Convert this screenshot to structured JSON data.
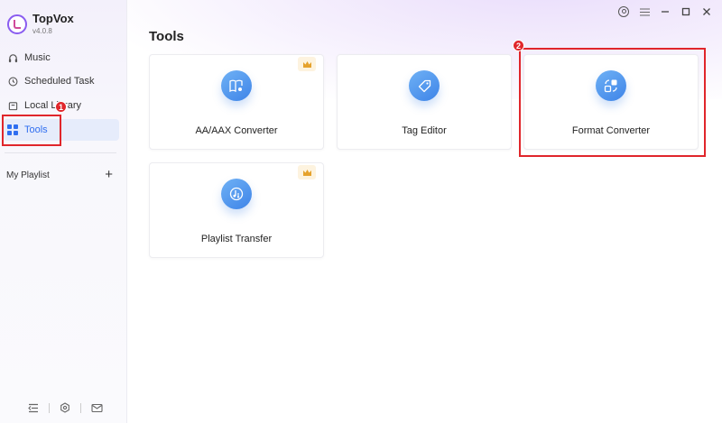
{
  "app": {
    "name": "TopVox",
    "version": "v4.0.8"
  },
  "sidebar": {
    "items": [
      {
        "label": "Music",
        "icon": "headphones-icon"
      },
      {
        "label": "Scheduled Task",
        "icon": "clock-icon"
      },
      {
        "label": "Local Library",
        "icon": "folder-icon"
      },
      {
        "label": "Tools",
        "icon": "grid-icon",
        "active": true
      }
    ],
    "playlist_label": "My Playlist",
    "add_symbol": "+"
  },
  "main": {
    "title": "Tools",
    "cards": [
      {
        "label": "AA/AAX Converter",
        "icon": "book-music-icon",
        "premium": true
      },
      {
        "label": "Tag Editor",
        "icon": "tag-icon",
        "premium": false
      },
      {
        "label": "Format Converter",
        "icon": "convert-icon",
        "premium": false
      },
      {
        "label": "Playlist Transfer",
        "icon": "music-transfer-icon",
        "premium": true
      }
    ]
  },
  "annotations": {
    "step1": "1",
    "step2": "2"
  },
  "colors": {
    "accent": "#2f6ef0",
    "highlight": "#e0262b",
    "icon_circle": "#3e84e8",
    "premium": "#e5a22d"
  }
}
